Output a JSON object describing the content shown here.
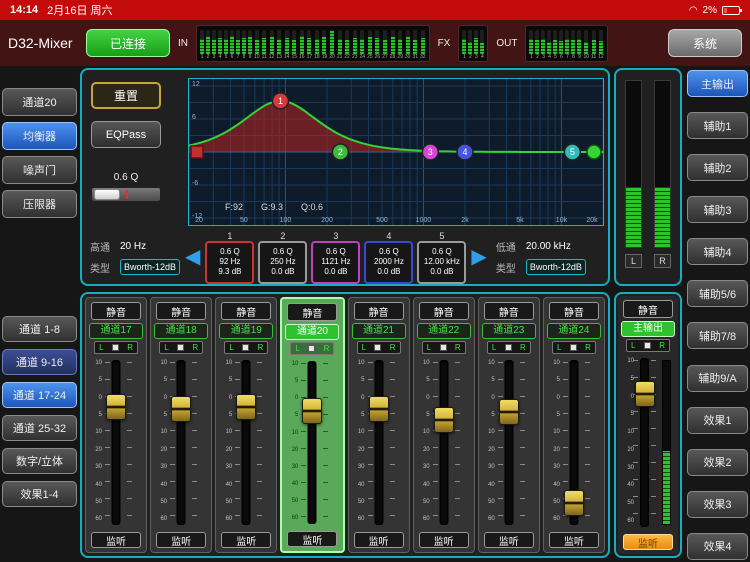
{
  "status_bar": {
    "time": "14:14",
    "date": "2月16日 周六",
    "battery": "2%"
  },
  "icons": {
    "wifi": "◠",
    "prev": "◀",
    "next": "▶"
  },
  "header": {
    "title": "D32-Mixer",
    "connect_button": "已连接",
    "system_button": "系统",
    "in_label": "IN",
    "fx_label": "FX",
    "out_label": "OUT",
    "in_meters": [
      0.62,
      0.7,
      0.55,
      0.66,
      0.6,
      0.72,
      0.58,
      0.64,
      0.68,
      0.56,
      0.63,
      0.7,
      0.6,
      0.66,
      0.58,
      0.71,
      0.64,
      0.6,
      0.68,
      0.95,
      0.62,
      0.57,
      0.66,
      0.6,
      0.7,
      0.63,
      0.58,
      0.67,
      0.61,
      0.69,
      0.56,
      0.64
    ],
    "fx_meters": [
      0.6,
      0.5,
      0.65,
      0.45
    ],
    "out_meters": [
      0.62,
      0.55,
      0.6,
      0.5,
      0.58,
      0.52,
      0.6,
      0.55,
      0.62,
      0.5,
      0.57,
      0.53
    ]
  },
  "left_nav_top": [
    {
      "label": "通道20",
      "state": ""
    },
    {
      "label": "均衡器",
      "state": "active"
    },
    {
      "label": "噪声门",
      "state": ""
    },
    {
      "label": "压限器",
      "state": ""
    }
  ],
  "left_nav_bottom": [
    {
      "label": "通道 1-8",
      "state": ""
    },
    {
      "label": "通道 9-16",
      "state": "navy"
    },
    {
      "label": "通道 17-24",
      "state": "active"
    },
    {
      "label": "通道 25-32",
      "state": ""
    },
    {
      "label": "数字/立体",
      "state": ""
    },
    {
      "label": "效果1-4",
      "state": ""
    }
  ],
  "right_nav": [
    {
      "label": "主输出",
      "state": "active"
    },
    {
      "label": "辅助1",
      "state": ""
    },
    {
      "label": "辅助2",
      "state": ""
    },
    {
      "label": "辅助3",
      "state": ""
    },
    {
      "label": "辅助4",
      "state": ""
    },
    {
      "label": "辅助5/6",
      "state": ""
    },
    {
      "label": "辅助7/8",
      "state": ""
    },
    {
      "label": "辅助9/A",
      "state": ""
    },
    {
      "label": "效果1",
      "state": ""
    },
    {
      "label": "效果2",
      "state": ""
    },
    {
      "label": "效果3",
      "state": ""
    },
    {
      "label": "效果4",
      "state": ""
    }
  ],
  "eq": {
    "reset_button": "重置",
    "eqpass_button": "EQPass",
    "q_value": "0.6 Q",
    "readout": {
      "f": "F:92",
      "g": "G:9.3",
      "q": "Q:0.6"
    },
    "hp": {
      "label": "高通",
      "value": "20 Hz",
      "type_label": "类型",
      "type_value": "Bworth-12dB"
    },
    "lp": {
      "label": "低通",
      "value": "20.00 kHz",
      "type_label": "类型",
      "type_value": "Bworth-12dB"
    },
    "bands": [
      {
        "num": "1",
        "freq_hz": 92,
        "gain_db": 9.3,
        "q": 0.6,
        "q_text": "0.6 Q",
        "freq_text": "92 Hz",
        "gain_text": "9.3 dB",
        "color": "#d43c3c",
        "box_border": "#cc3333"
      },
      {
        "num": "2",
        "freq_hz": 250,
        "gain_db": 0,
        "q": 0.6,
        "q_text": "0.6 Q",
        "freq_text": "250 Hz",
        "gain_text": "0.0 dB",
        "color": "#3cbb3c",
        "box_border": "#9a9a9a"
      },
      {
        "num": "3",
        "freq_hz": 1121,
        "gain_db": 0,
        "q": 0.6,
        "q_text": "0.6 Q",
        "freq_text": "1121 Hz",
        "gain_text": "0.0 dB",
        "color": "#d446d4",
        "box_border": "#c040c0"
      },
      {
        "num": "4",
        "freq_hz": 2000,
        "gain_db": 0,
        "q": 0.6,
        "q_text": "0.6 Q",
        "freq_text": "2000 Hz",
        "gain_text": "0.0 dB",
        "color": "#4655e0",
        "box_border": "#3a4ad0"
      },
      {
        "num": "5",
        "freq_hz": 12000,
        "gain_db": 0,
        "q": 0.6,
        "q_text": "0.6 Q",
        "freq_text": "12.00 kHz",
        "gain_text": "0.0 dB",
        "color": "#35b8b8",
        "box_border": "#9a9a9a"
      }
    ],
    "freq_ticks": [
      {
        "f": 20,
        "label": "20"
      },
      {
        "f": 50,
        "label": "50"
      },
      {
        "f": 100,
        "label": "100"
      },
      {
        "f": 200,
        "label": "200"
      },
      {
        "f": 500,
        "label": "500"
      },
      {
        "f": 1000,
        "label": "1000"
      },
      {
        "f": 2000,
        "label": "2k"
      },
      {
        "f": 5000,
        "label": "5k"
      },
      {
        "f": 10000,
        "label": "10k"
      },
      {
        "f": 20000,
        "label": "20k"
      }
    ],
    "db_ticks": [
      {
        "db": 12,
        "label": "12"
      },
      {
        "db": 6,
        "label": "6"
      },
      {
        "db": -6,
        "label": "-6"
      },
      {
        "db": -12,
        "label": "-12"
      }
    ]
  },
  "pan": {
    "l": "L",
    "r": "R"
  },
  "fader_scale": [
    "10",
    "5",
    "0",
    "5",
    "10",
    "20",
    "30",
    "40",
    "50",
    "60"
  ],
  "strips": [
    {
      "mute": "静音",
      "label": "通道17",
      "listen": "监听",
      "fader": 0.24,
      "selected": false
    },
    {
      "mute": "静音",
      "label": "通道18",
      "listen": "监听",
      "fader": 0.25,
      "selected": false
    },
    {
      "mute": "静音",
      "label": "通道19",
      "listen": "监听",
      "fader": 0.24,
      "selected": false
    },
    {
      "mute": "静音",
      "label": "通道20",
      "listen": "监听",
      "fader": 0.26,
      "selected": true
    },
    {
      "mute": "静音",
      "label": "通道21",
      "listen": "监听",
      "fader": 0.25,
      "selected": false
    },
    {
      "mute": "静音",
      "label": "通道22",
      "listen": "监听",
      "fader": 0.33,
      "selected": false
    },
    {
      "mute": "静音",
      "label": "通道23",
      "listen": "监听",
      "fader": 0.27,
      "selected": false
    },
    {
      "mute": "静音",
      "label": "通道24",
      "listen": "监听",
      "fader": 0.9,
      "selected": false
    }
  ],
  "main_strip": {
    "mute": "静音",
    "label": "主输出",
    "listen": "监听",
    "fader": 0.16,
    "meter": 0.45,
    "selected": false
  },
  "main_meter": {
    "l_label": "L",
    "r_label": "R",
    "l_level": 0.36,
    "r_level": 0.36
  }
}
